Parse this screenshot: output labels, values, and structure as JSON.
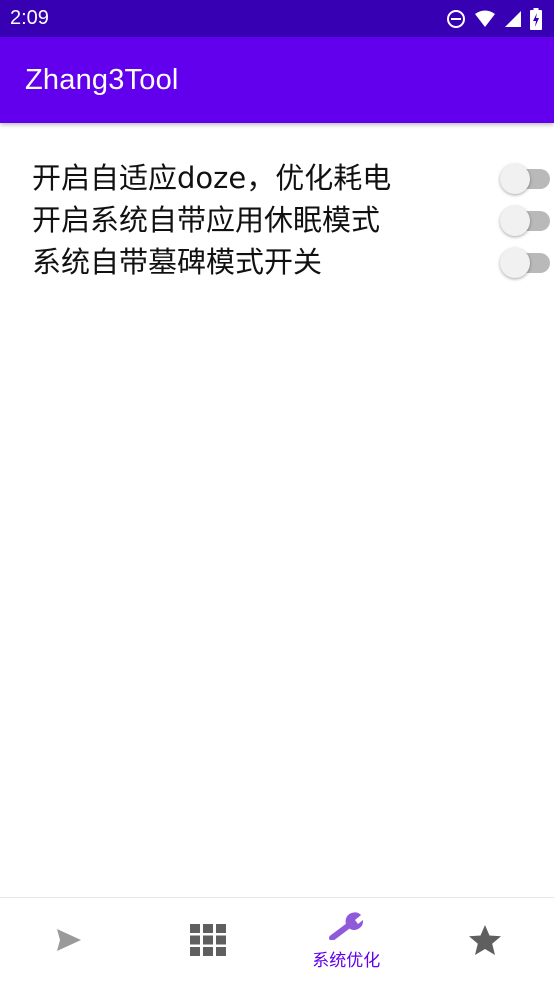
{
  "status_bar": {
    "time": "2:09",
    "icons": [
      "do-not-disturb-icon",
      "wifi-icon",
      "cell-signal-icon",
      "battery-charging-icon"
    ]
  },
  "app_bar": {
    "title": "Zhang3Tool"
  },
  "settings": [
    {
      "label": "开启自适应doze，优化耗电",
      "enabled": false
    },
    {
      "label": "开启系统自带应用休眠模式",
      "enabled": false
    },
    {
      "label": "系统自带墓碑模式开关",
      "enabled": false
    }
  ],
  "bottom_nav": {
    "items": [
      {
        "icon": "send-icon",
        "label": "",
        "selected": false
      },
      {
        "icon": "apps-grid-icon",
        "label": "",
        "selected": false
      },
      {
        "icon": "wrench-icon",
        "label": "系统优化",
        "selected": true
      },
      {
        "icon": "star-icon",
        "label": "",
        "selected": false
      }
    ]
  },
  "colors": {
    "status_bar": "#3700b3",
    "primary": "#6200ee",
    "selected_icon": "#8f5ad9",
    "unselected_icon": "#5f5f5f"
  }
}
